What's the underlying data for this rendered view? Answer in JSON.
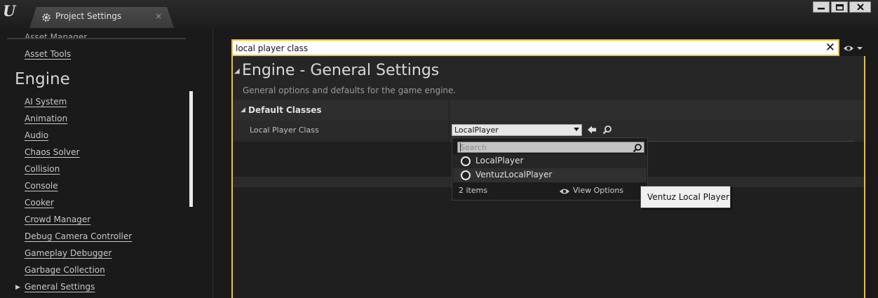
{
  "window": {
    "tab_title": "Project Settings",
    "tab_close": "×"
  },
  "sidebar": {
    "cut_item": "Asset Manager",
    "asset_tools": "Asset Tools",
    "heading": "Engine",
    "items": [
      "AI System",
      "Animation",
      "Audio",
      "Chaos Solver",
      "Collision",
      "Console",
      "Cooker",
      "Crowd Manager",
      "Debug Camera Controller",
      "Gameplay Debugger",
      "Garbage Collection",
      "General Settings"
    ]
  },
  "search": {
    "value": "local player class"
  },
  "section": {
    "title": "Engine - General Settings",
    "description": "General options and defaults for the game engine."
  },
  "category": {
    "label": "Default Classes"
  },
  "property": {
    "label": "Local Player Class",
    "value": "LocalPlayer"
  },
  "popup": {
    "search_placeholder": "Search",
    "options": [
      "LocalPlayer",
      "VentuzLocalPlayer"
    ],
    "count": "2 items",
    "view_options": "View Options"
  },
  "tooltip": {
    "text": "Ventuz Local Player"
  },
  "colors": {
    "accent": "#f2c028",
    "background": "#1a1a1a"
  }
}
